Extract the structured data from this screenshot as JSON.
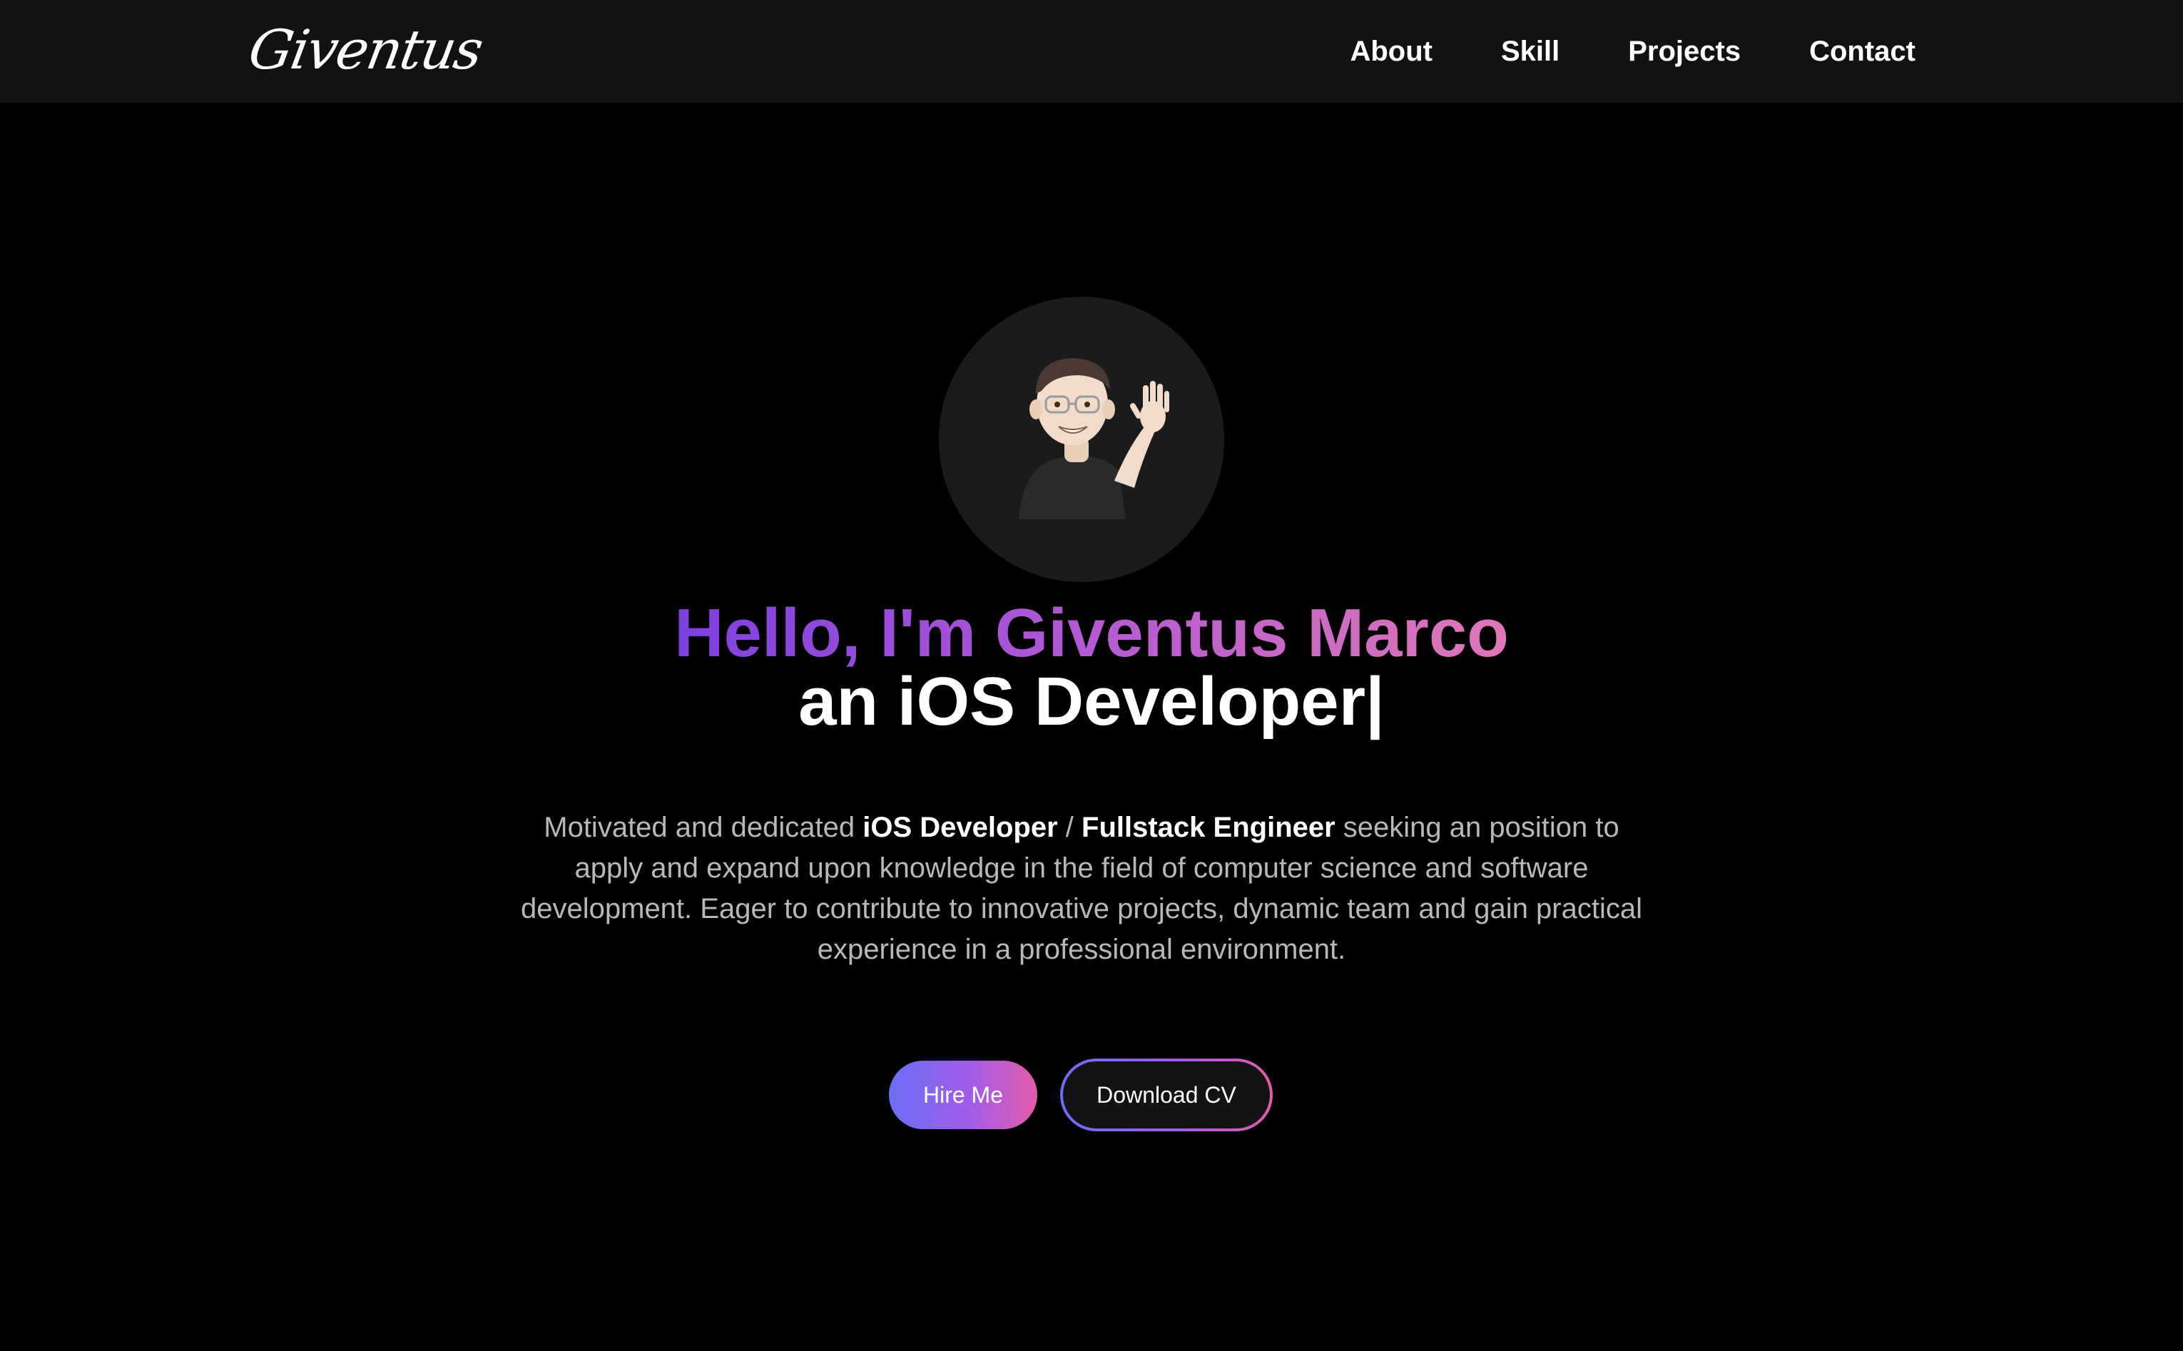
{
  "navbar": {
    "logo": "Giventus",
    "links": [
      {
        "label": "About"
      },
      {
        "label": "Skill"
      },
      {
        "label": "Projects"
      },
      {
        "label": "Contact"
      }
    ]
  },
  "hero": {
    "greeting": "Hello, I'm Giventus Marco",
    "role_text": "an iOS Developer|",
    "description": {
      "part1": "Motivated and dedicated ",
      "bold1": "iOS Developer",
      "sep": " / ",
      "bold2": "Fullstack Engineer",
      "part2": " seeking an position to apply and expand upon knowledge in the field of computer science and software development. Eager to contribute to innovative projects, dynamic team and gain practical experience in a professional environment."
    },
    "buttons": {
      "hire": "Hire Me",
      "download": "Download CV"
    }
  },
  "colors": {
    "background": "#000000",
    "navbar": "#121212",
    "gradient_start": "#6a6ef5",
    "gradient_end": "#e25ba9",
    "greeting_start": "#7e3fe0",
    "greeting_end": "#e077b8"
  }
}
